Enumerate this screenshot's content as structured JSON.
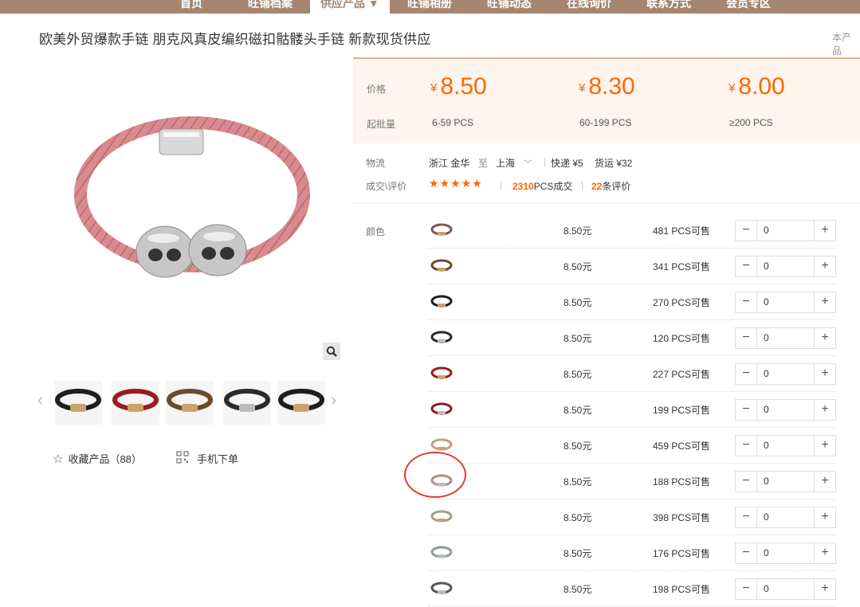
{
  "nav": {
    "items": [
      "首页",
      "旺铺档案",
      "供应产品 ▼",
      "旺铺相册",
      "旺铺动态",
      "在线询价",
      "联系方式",
      "会员专区"
    ],
    "active_index": 2
  },
  "product": {
    "title": "欧美外贸爆款手链 朋克风真皮编织磁扣骷髅头手链 新款现货供应",
    "scope_label": "本产品"
  },
  "gallery": {
    "thumb_count": 5,
    "zoom_icon": "magnifier-icon",
    "prev_icon": "chevron-left-icon",
    "next_icon": "chevron-right-icon"
  },
  "actions": {
    "favorite_label": "收藏产品（88）",
    "mobile_label": "手机下单"
  },
  "pricing": {
    "price_label": "价格",
    "moq_label": "起批量",
    "currency": "¥",
    "tiers": [
      {
        "price": "8.50",
        "range": "6-59  PCS"
      },
      {
        "price": "8.30",
        "range": "60-199  PCS"
      },
      {
        "price": "8.00",
        "range": "≥200  PCS"
      }
    ]
  },
  "logistics": {
    "label": "物流",
    "from": "浙江 金华",
    "to_word": "至",
    "to": "上海",
    "express": "快递 ¥5",
    "freight": "货运 ¥32"
  },
  "deals": {
    "label": "成交\\评价",
    "stars": "★★★★★",
    "sold_count": "2310",
    "sold_suffix": "PCS成交",
    "review_count": "22",
    "review_suffix": "条评价"
  },
  "sku": {
    "color_label": "颜色",
    "rows": [
      {
        "price": "8.50元",
        "stock": "481 PCS可售",
        "qty": "0",
        "band": "#7a5a52",
        "accent": "#c9a36a"
      },
      {
        "price": "8.50元",
        "stock": "341 PCS可售",
        "qty": "0",
        "band": "#6e4a2a",
        "accent": "#c9a36a"
      },
      {
        "price": "8.50元",
        "stock": "270 PCS可售",
        "qty": "0",
        "band": "#1e1e1e",
        "accent": "#c9a36a"
      },
      {
        "price": "8.50元",
        "stock": "120 PCS可售",
        "qty": "0",
        "band": "#2a2a2a",
        "accent": "#bcbcbc"
      },
      {
        "price": "8.50元",
        "stock": "227 PCS可售",
        "qty": "0",
        "band": "#9a1c1c",
        "accent": "#c9a36a"
      },
      {
        "price": "8.50元",
        "stock": "199 PCS可售",
        "qty": "0",
        "band": "#8a1d1d",
        "accent": "#bcbcbc"
      },
      {
        "price": "8.50元",
        "stock": "459 PCS可售",
        "qty": "0",
        "band": "#c99a8a",
        "accent": "#c9a36a"
      },
      {
        "price": "8.50元",
        "stock": "188 PCS可售",
        "qty": "0",
        "band": "#b7888a",
        "accent": "#bcbcbc"
      },
      {
        "price": "8.50元",
        "stock": "398 PCS可售",
        "qty": "0",
        "band": "#a89c8a",
        "accent": "#c9a36a"
      },
      {
        "price": "8.50元",
        "stock": "176 PCS可售",
        "qty": "0",
        "band": "#8f9a8f",
        "accent": "#bcbcbc"
      },
      {
        "price": "8.50元",
        "stock": "198 PCS可售",
        "qty": "0",
        "band": "#555555",
        "accent": "#bcbcbc"
      }
    ]
  },
  "colors": {
    "nav_bg": "#a58671",
    "price_orange": "#ff6600",
    "panel_bg": "#fff4ee",
    "highlight_red": "#e23b2e"
  }
}
